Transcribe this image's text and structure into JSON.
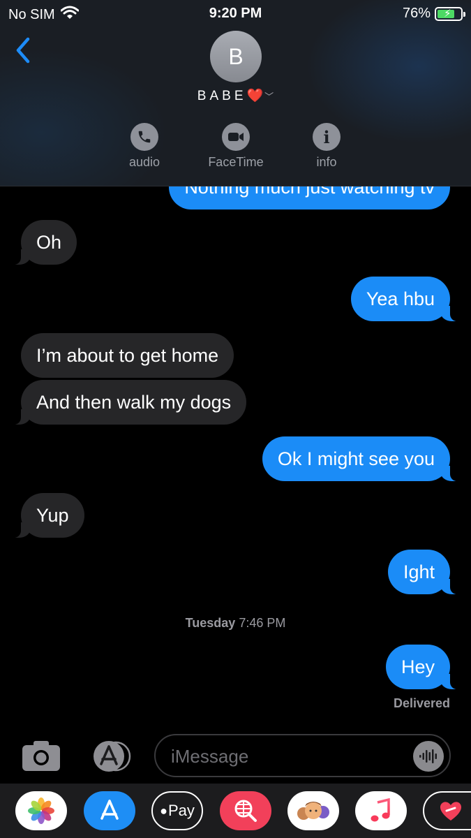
{
  "status": {
    "carrier": "No SIM",
    "time": "9:20 PM",
    "battery": "76%"
  },
  "contact": {
    "initial": "B",
    "name": "BABE",
    "emoji": "❤️"
  },
  "actions": [
    {
      "label": "audio",
      "icon": "phone-icon"
    },
    {
      "label": "FaceTime",
      "icon": "video-icon"
    },
    {
      "label": "info",
      "icon": "info-icon"
    }
  ],
  "messages": {
    "m0": "Nothing much just watching tv",
    "m1": "Oh",
    "m2": "Yea hbu",
    "m3": "I’m about to get home",
    "m4": "And then walk my dogs",
    "m5": "Ok I might see you",
    "m6": "Yup",
    "m7": "Ight",
    "m8": "Hey"
  },
  "timestamp": {
    "day": "Tuesday",
    "time": "7:46 PM"
  },
  "delivered": "Delivered",
  "composer": {
    "placeholder": "iMessage"
  },
  "drawer": {
    "applepay_label": "Pay"
  },
  "colors": {
    "outgoing": "#1b8cf7",
    "incoming": "#262628",
    "accent": "#1d8cf8"
  }
}
